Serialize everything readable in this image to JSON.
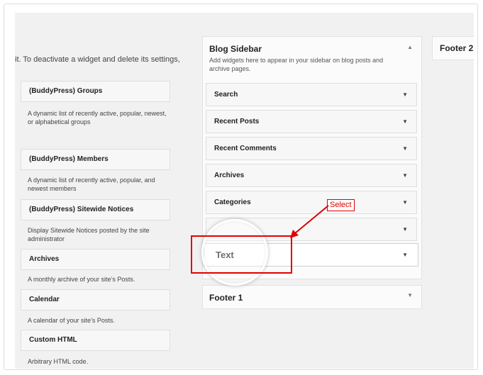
{
  "intro_text": "it. To deactivate a widget and delete its settings,",
  "available_widgets": [
    {
      "title": "(BuddyPress) Groups",
      "description": "A dynamic list of recently active, popular, newest, or alphabetical groups"
    },
    {
      "title": "(BuddyPress) Members",
      "description": "A dynamic list of recently active, popular, and newest members"
    },
    {
      "title": "(BuddyPress) Sitewide Notices",
      "description": "Display Sitewide Notices posted by the site administrator"
    },
    {
      "title": "Archives",
      "description": "A monthly archive of your site’s Posts."
    },
    {
      "title": "Calendar",
      "description": "A calendar of your site’s Posts."
    },
    {
      "title": "Custom HTML",
      "description": "Arbitrary HTML code."
    }
  ],
  "blog_sidebar": {
    "title": "Blog Sidebar",
    "description": "Add widgets here to appear in your sidebar on blog posts and archive pages.",
    "toggle_icon": "triangle-up",
    "widgets": [
      "Search",
      "Recent Posts",
      "Recent Comments",
      "Archives",
      "Categories",
      ""
    ],
    "widget_arrow": "▼"
  },
  "dragged_widget": {
    "title": "Text",
    "arrow": "▼"
  },
  "footer1": {
    "title": "Footer 1",
    "toggle_icon": "triangle-down"
  },
  "footer2": {
    "title": "Footer 2"
  },
  "annotation": {
    "label": "Select",
    "color": "#e00000"
  }
}
